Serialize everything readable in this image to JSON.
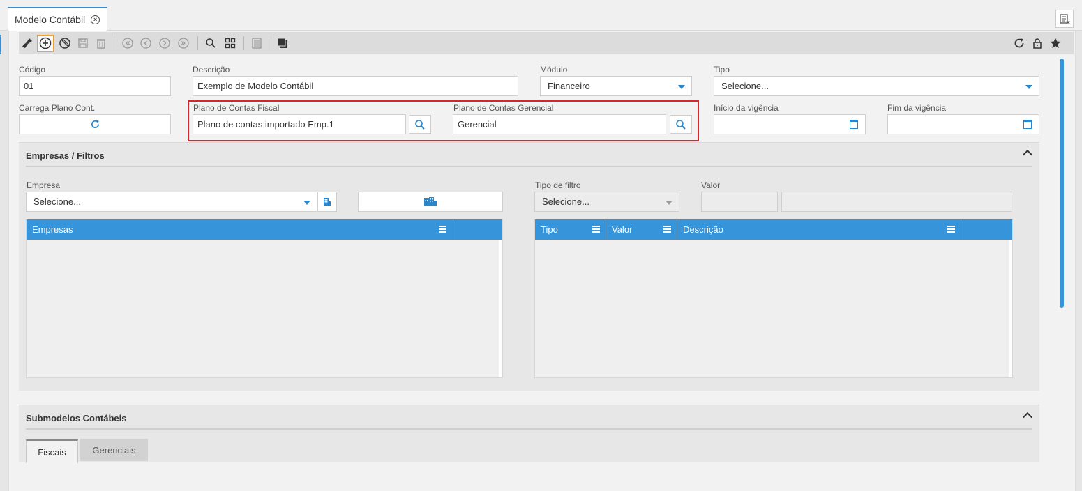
{
  "window": {
    "tab_title": "Modelo Contábil"
  },
  "toolbar": {
    "buttons": [
      "broom-icon",
      "add-icon",
      "cancel-icon",
      "save-icon",
      "delete-icon",
      "first-icon",
      "previous-icon",
      "next-icon",
      "last-icon",
      "search-icon",
      "grid-icon",
      "report-icon",
      "copy-icon"
    ],
    "right_buttons": [
      "refresh-icon",
      "lock-icon",
      "star-icon"
    ]
  },
  "form": {
    "codigo": {
      "label": "Código",
      "value": "01"
    },
    "descricao": {
      "label": "Descrição",
      "value": "Exemplo de Modelo Contábil"
    },
    "modulo": {
      "label": "Módulo",
      "value": "Financeiro"
    },
    "tipo": {
      "label": "Tipo",
      "value": "Selecione..."
    },
    "carrega_plano": {
      "label": "Carrega Plano Cont."
    },
    "plano_fiscal": {
      "label": "Plano de Contas Fiscal",
      "value": "Plano de contas importado Emp.1"
    },
    "plano_gerencial": {
      "label": "Plano de Contas Gerencial",
      "value": "Gerencial"
    },
    "inicio_vigencia": {
      "label": "Início da vigência",
      "value": ""
    },
    "fim_vigencia": {
      "label": "Fim da vigência",
      "value": ""
    }
  },
  "empresas_panel": {
    "title": "Empresas / Filtros",
    "empresa": {
      "label": "Empresa",
      "value": "Selecione..."
    },
    "tipo_filtro": {
      "label": "Tipo de filtro",
      "value": "Selecione..."
    },
    "valor": {
      "label": "Valor"
    },
    "empresas_grid": {
      "columns": [
        "Empresas"
      ]
    },
    "filtros_grid": {
      "columns": [
        "Tipo",
        "Valor",
        "Descrição"
      ]
    }
  },
  "submodelos_panel": {
    "title": "Submodelos Contábeis",
    "tabs": [
      "Fiscais",
      "Gerenciais"
    ]
  },
  "colors": {
    "accent": "#3594da",
    "highlight": "#d9242b"
  }
}
